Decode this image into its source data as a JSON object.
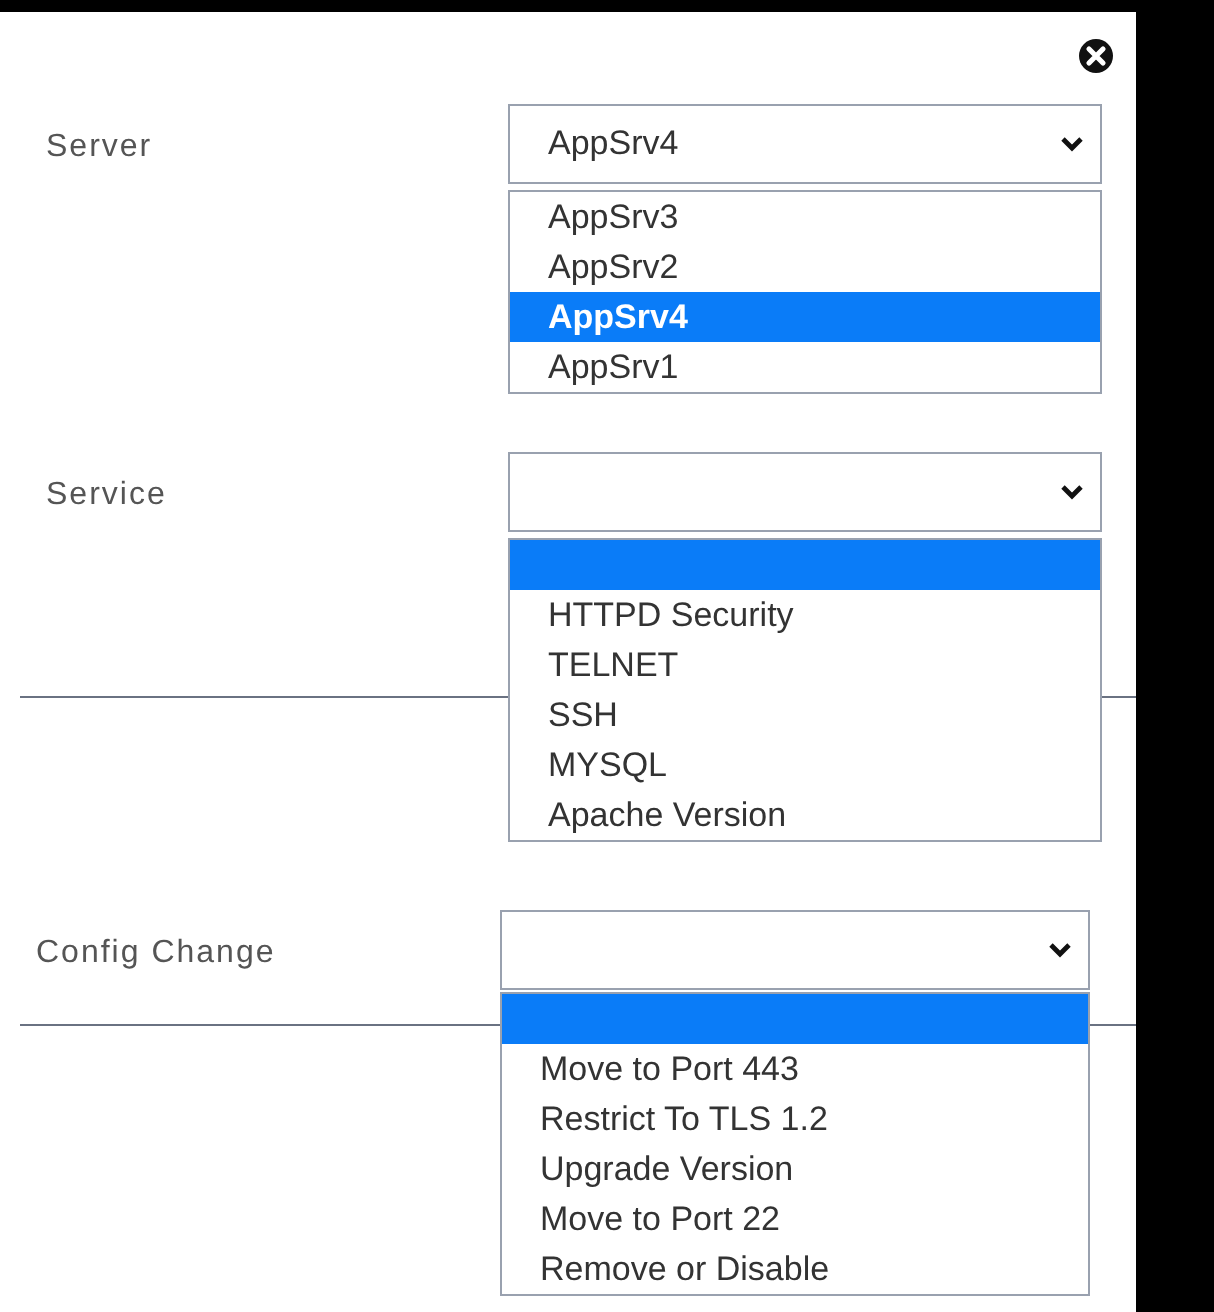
{
  "fields": [
    {
      "label": "Server",
      "value": "AppSrv4",
      "options": [
        {
          "label": "AppSrv3",
          "selected": false
        },
        {
          "label": "AppSrv2",
          "selected": false
        },
        {
          "label": "AppSrv4",
          "selected": true
        },
        {
          "label": "AppSrv1",
          "selected": false
        }
      ]
    },
    {
      "label": "Service",
      "options": [
        {
          "selected": true
        },
        {
          "label": "HTTPD Security",
          "selected": false
        },
        {
          "label": "TELNET",
          "selected": false
        },
        {
          "label": "SSH",
          "selected": false
        },
        {
          "label": "MYSQL",
          "selected": false
        },
        {
          "label": "Apache Version",
          "selected": false
        }
      ]
    },
    {
      "label": "Config Change",
      "options": [
        {
          "selected": true
        },
        {
          "label": "Move to Port 443",
          "selected": false
        },
        {
          "label": "Restrict To TLS 1.2",
          "selected": false
        },
        {
          "label": "Upgrade Version",
          "selected": false
        },
        {
          "label": "Move to Port 22",
          "selected": false
        },
        {
          "label": "Remove or Disable",
          "selected": false
        }
      ]
    }
  ]
}
